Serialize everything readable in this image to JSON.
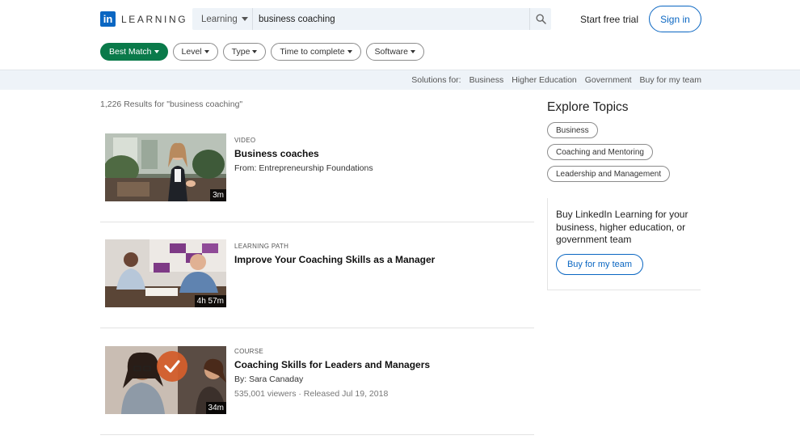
{
  "header": {
    "logo_letters": "in",
    "logo_word": "LEARNING",
    "search_scope": "Learning",
    "search_value": "business coaching",
    "start_trial": "Start free trial",
    "sign_in": "Sign in"
  },
  "filters": [
    {
      "label": "Best Match",
      "active": true
    },
    {
      "label": "Level"
    },
    {
      "label": "Type"
    },
    {
      "label": "Time to complete"
    },
    {
      "label": "Software"
    }
  ],
  "solutions": {
    "label": "Solutions for:",
    "items": [
      "Business",
      "Higher Education",
      "Government",
      "Buy for my team"
    ]
  },
  "results_count": "1,226 Results for \"business coaching\"",
  "results": [
    {
      "type": "VIDEO",
      "title": "Business coaches",
      "sub": "From: Entrepreneurship Foundations",
      "stats": "",
      "duration": "3m"
    },
    {
      "type": "LEARNING PATH",
      "title": "Improve Your Coaching Skills as a Manager",
      "sub": "",
      "stats": "",
      "duration": "4h 57m"
    },
    {
      "type": "COURSE",
      "title": "Coaching Skills for Leaders and Managers",
      "sub": "By: Sara Canaday",
      "stats": "535,001 viewers · Released Jul 19, 2018",
      "duration": "34m"
    }
  ],
  "sidebar": {
    "explore_title": "Explore Topics",
    "topics": [
      "Business",
      "Coaching and Mentoring",
      "Leadership and Management"
    ],
    "buy_text": "Buy LinkedIn Learning for your business, higher education, or government team",
    "buy_button": "Buy for my team"
  },
  "colors": {
    "brand_blue": "#0a66c2",
    "best_match_green": "#0a7a4a",
    "bar_bg": "#eef3f8"
  },
  "icons": {
    "search": "search-icon",
    "caret": "caret-down-icon",
    "badge": "checkmark-badge-icon"
  }
}
